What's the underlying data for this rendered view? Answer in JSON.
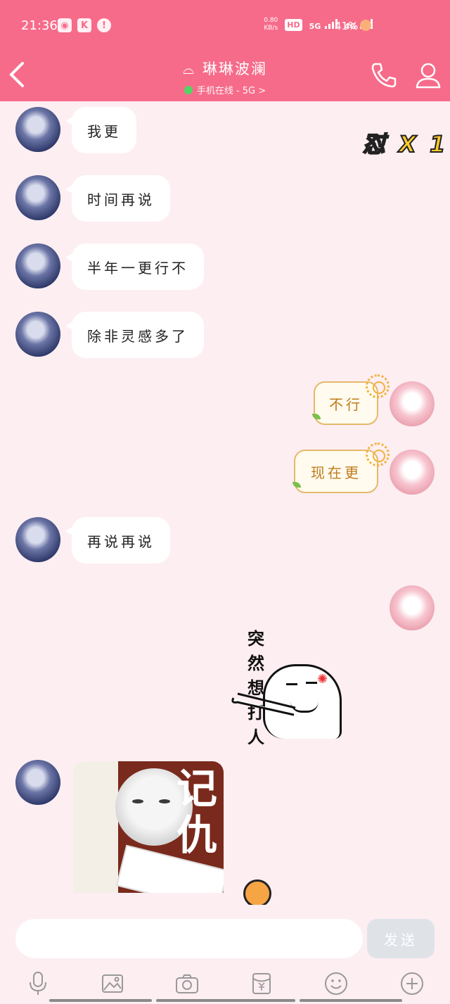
{
  "status": {
    "time": "21:36",
    "speed_value": "0.80",
    "speed_unit": "KB/s",
    "hd_label": "HD",
    "net1": "5G",
    "net2": "4G",
    "battery": "41%"
  },
  "header": {
    "back_glyph": "<",
    "title": "琳琳波澜",
    "subtitle": "手机在线 - 5G >"
  },
  "badge": {
    "text": "怼 X 1"
  },
  "messages": [
    {
      "side": "left",
      "text": "我更"
    },
    {
      "side": "left",
      "text": "时间再说"
    },
    {
      "side": "left",
      "text": "半年一更行不"
    },
    {
      "side": "left",
      "text": "除非灵感多了"
    },
    {
      "side": "right",
      "text": "不行"
    },
    {
      "side": "right",
      "text": "现在更"
    },
    {
      "side": "left",
      "text": "再说再说"
    },
    {
      "side": "right",
      "type": "sticker",
      "text": "突然想打人"
    },
    {
      "side": "left",
      "type": "sticker",
      "text": "记仇"
    }
  ],
  "input": {
    "placeholder": "",
    "send_label": "发送"
  },
  "toolbar": [
    "mic-icon",
    "image-icon",
    "camera-icon",
    "red-packet-icon",
    "emoji-icon",
    "plus-icon"
  ],
  "colors": {
    "header": "#f76b8a",
    "background": "#fdeef2",
    "bubble_left": "#ffffff",
    "bubble_right_border": "#e4b96a",
    "online_dot": "#4cd964"
  }
}
